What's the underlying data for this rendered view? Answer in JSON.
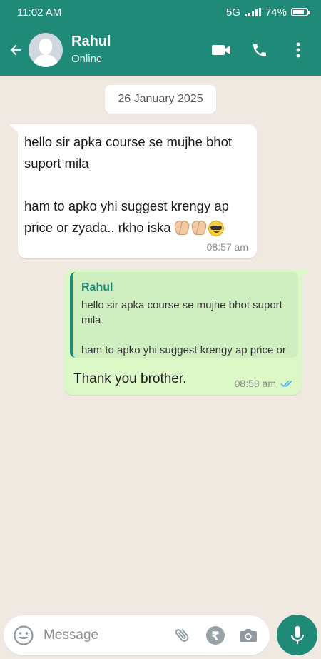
{
  "status_bar": {
    "time": "11:02 AM",
    "network": "5G",
    "battery": "74%"
  },
  "header": {
    "contact_name": "Rahul",
    "contact_status": "Online",
    "icons": [
      "back-arrow-icon",
      "video-call-icon",
      "voice-call-icon",
      "more-options-icon"
    ]
  },
  "chat": {
    "date_divider": "26 January 2025",
    "incoming": {
      "text": " hello sir apka course se mujhe bhot suport mila\n\nham to apko yhi suggest krengy ap price or zyada.. rkho iska",
      "emojis": [
        "folded-hands",
        "folded-hands",
        "smiling-face-with-sunglasses"
      ],
      "time": "08:57 am"
    },
    "outgoing": {
      "quoted_name": "Rahul",
      "quoted_text": "hello sir apka course se mujhe bhot suport mila\n\nham to apko yhi suggest krengy ap price or zyada.. rkho iska",
      "text": "Thank you brother.",
      "time": "08:58 am",
      "read_status": "read"
    }
  },
  "composer": {
    "placeholder": "Message",
    "icons": [
      "emoji-icon",
      "attach-icon",
      "rupee-icon",
      "camera-icon",
      "mic-icon"
    ]
  },
  "colors": {
    "primary": "#1f8a78",
    "outgoing_bubble": "#dcf8c6",
    "read_ticks": "#4fb6ec",
    "background": "#efe9e2"
  }
}
